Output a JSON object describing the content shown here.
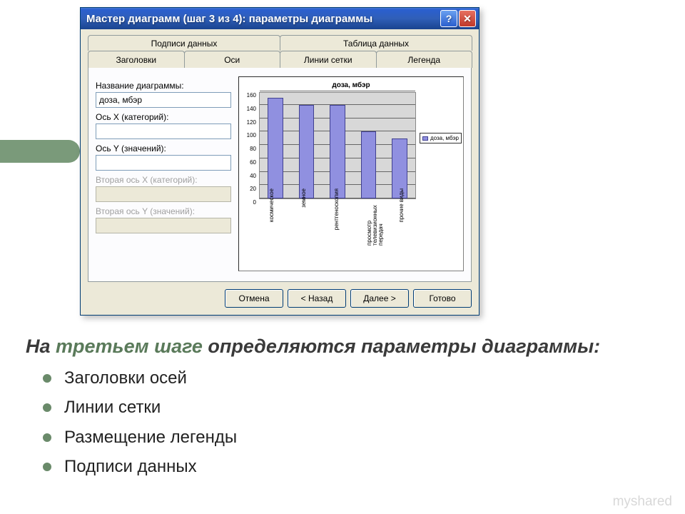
{
  "dialog": {
    "title": "Мастер диаграмм (шаг 3 из 4): параметры диаграммы",
    "tabs_top": [
      {
        "label": "Подписи данных"
      },
      {
        "label": "Таблица данных"
      }
    ],
    "tabs_bottom": [
      {
        "label": "Заголовки",
        "active": true
      },
      {
        "label": "Оси"
      },
      {
        "label": "Линии сетки"
      },
      {
        "label": "Легенда"
      }
    ],
    "form": {
      "chart_name_label": "Название диаграммы:",
      "chart_name_value": "доза, мбэр",
      "axis_x_label": "Ось X (категорий):",
      "axis_x_value": "",
      "axis_y_label": "Ось Y (значений):",
      "axis_y_value": "",
      "axis_x2_label": "Вторая ось X (категорий):",
      "axis_y2_label": "Вторая ось Y (значений):"
    },
    "buttons": {
      "cancel": "Отмена",
      "back": "< Назад",
      "next": "Далее >",
      "finish": "Готово"
    },
    "preview": {
      "title": "доза, мбэр",
      "legend": "доза, мбэр"
    }
  },
  "slide": {
    "heading_prefix": "На ",
    "heading_hl": "третьем шаге",
    "heading_suffix": " определяются параметры диаграммы:",
    "items": [
      "Заголовки осей",
      "Линии сетки",
      "Размещение легенды",
      "Подписи данных"
    ],
    "watermark": "myshared"
  },
  "chart_data": {
    "type": "bar",
    "title": "доза, мбэр",
    "categories": [
      "космическое",
      "земное",
      "рентгеноскопия",
      "просмотр телевизионных передач",
      "прочие виды"
    ],
    "values": [
      150,
      140,
      140,
      100,
      90
    ],
    "ylabel": "",
    "xlabel": "",
    "ylim": [
      0,
      160
    ],
    "y_ticks": [
      0,
      20,
      40,
      60,
      80,
      100,
      120,
      140,
      160
    ],
    "legend": [
      "доза, мбэр"
    ]
  }
}
